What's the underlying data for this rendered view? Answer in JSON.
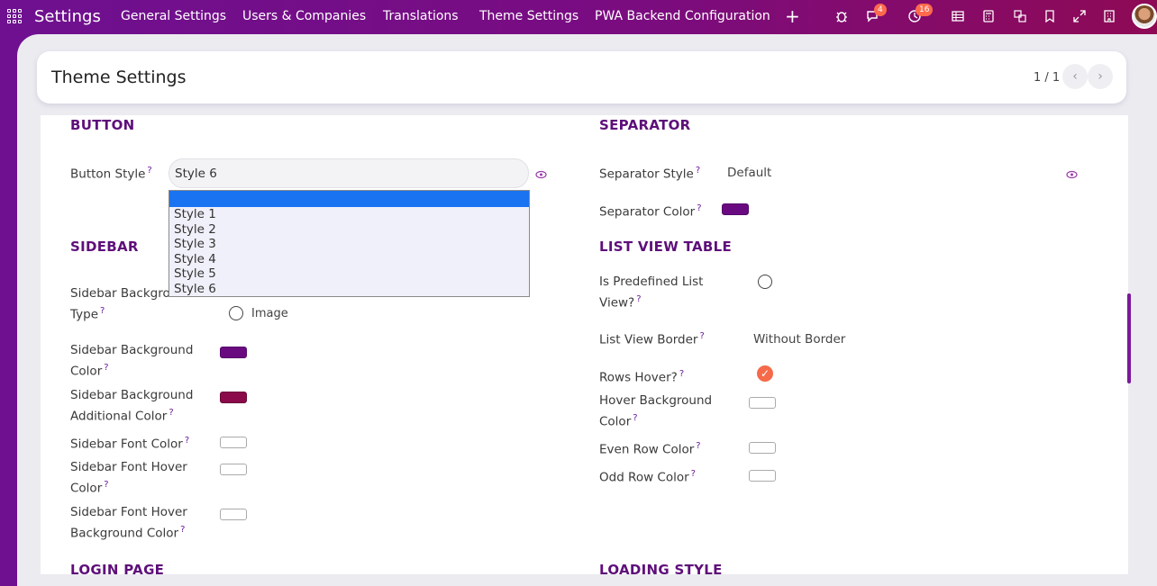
{
  "navbar": {
    "app_name": "Settings",
    "menu": [
      "General Settings",
      "Users & Companies",
      "Translations",
      "Theme Settings",
      "PWA Backend Configuration"
    ],
    "plus": "+",
    "chat_badge": "4",
    "activity_badge": "16"
  },
  "control_panel": {
    "title": "Theme Settings",
    "pager": "1 / 1",
    "prev": "‹",
    "next": "›"
  },
  "button_section": {
    "title": "BUTTON",
    "style_label": "Button Style",
    "style_value": "Style 6",
    "options": [
      "",
      "Style 1",
      "Style 2",
      "Style 3",
      "Style 4",
      "Style 5",
      "Style 6"
    ]
  },
  "separator_section": {
    "title": "SEPARATOR",
    "style_label": "Separator Style",
    "style_value": "Default",
    "color_label": "Separator Color",
    "color": "#6a0a80"
  },
  "sidebar_section": {
    "title": "SIDEBAR",
    "bg_type_label": "Sidebar Background Type",
    "bg_type_option": "Image",
    "bg_color_label": "Sidebar Background Color",
    "bg_color": "#6a0a80",
    "bg_add_color_label": "Sidebar Background Additional Color",
    "bg_add_color": "#8a0a4a",
    "font_color_label": "Sidebar Font Color",
    "font_hover_label": "Sidebar Font Hover Color",
    "font_hover_bg_label": "Sidebar Font Hover Background Color"
  },
  "list_view_section": {
    "title": "LIST VIEW TABLE",
    "predefined_label": "Is Predefined List View?",
    "border_label": "List View Border",
    "border_value": "Without Border",
    "rows_hover_label": "Rows Hover?",
    "hover_bg_label": "Hover Background Color",
    "even_row_label": "Even Row Color",
    "odd_row_label": "Odd Row Color"
  },
  "bottom_sections": {
    "login": "LOGIN PAGE",
    "loading": "LOADING STYLE"
  },
  "help_mark": "?",
  "icons": [
    "app-grid-icon",
    "bug-icon",
    "chat-icon",
    "clock-icon",
    "table-icon",
    "calculator-icon",
    "translate-icon",
    "bookmark-icon",
    "expand-icon",
    "building-icon",
    "eye-icon",
    "check-icon"
  ]
}
